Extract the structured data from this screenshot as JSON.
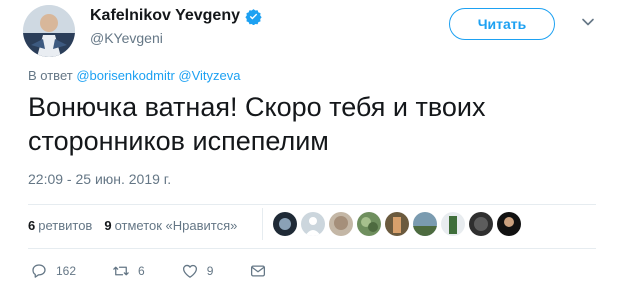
{
  "author": {
    "name": "Kafelnikov Yevgeny",
    "handle": "@KYevgeni"
  },
  "follow_label": "Читать",
  "reply": {
    "prefix": "В ответ",
    "users": [
      "@borisenkodmitr",
      "@Vityzeva"
    ]
  },
  "tweet": {
    "line1": "Вонючка ватная! Скоро тебя и твоих",
    "line2": "сторонников испепелим"
  },
  "timestamp": "22:09 - 25 июн. 2019 г.",
  "stats": {
    "retweets_count": "6",
    "retweets_label": "ретвитов",
    "likes_count": "9",
    "likes_label": "отметок «Нравится»"
  },
  "actions": {
    "reply_count": "162",
    "retweet_count": "6",
    "like_count": "9"
  },
  "colors": {
    "accent": "#1da1f2",
    "muted": "#657786",
    "text": "#14171a"
  }
}
